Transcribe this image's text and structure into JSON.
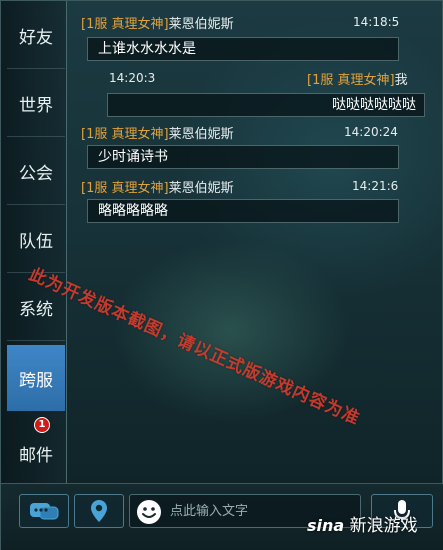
{
  "sidebar": {
    "items": [
      {
        "label": "好友"
      },
      {
        "label": "世界"
      },
      {
        "label": "公会"
      },
      {
        "label": "队伍"
      },
      {
        "label": "系统"
      },
      {
        "label": "跨服"
      },
      {
        "label": "邮件",
        "badge": "1"
      }
    ],
    "active_index": 5
  },
  "messages": [
    {
      "channel": "[1服",
      "sender": "真理女神]",
      "name": "莱恩伯妮斯",
      "time": "14:18:5",
      "text": "上谁水水水水是",
      "own": false
    },
    {
      "channel": "[1服",
      "sender": "真理女神]",
      "name": "我",
      "time": "14:20:3",
      "text": "哒哒哒哒哒哒",
      "own": true
    },
    {
      "channel": "[1服",
      "sender": "真理女神]",
      "name": "莱恩伯妮斯",
      "time": "14:20:24",
      "text": "少时诵诗书",
      "own": false
    },
    {
      "channel": "[1服",
      "sender": "真理女神]",
      "name": "莱恩伯妮斯",
      "time": "14:21:6",
      "text": "略略略略略",
      "own": false
    }
  ],
  "watermark": "此为开发版本截图，请以正式版游戏内容为准",
  "input": {
    "placeholder": "点此输入文字"
  },
  "icons": {
    "emote_button": "chat-bubbles-icon",
    "location_button": "location-pin-icon",
    "emoji": "smiley-icon",
    "voice_button": "microphone-icon"
  },
  "branding": {
    "sina": "sina",
    "text": "新浪游戏"
  },
  "colors": {
    "accent": "#3f86c7",
    "channel": "#e2a23a",
    "badge": "#d11a1a",
    "watermark": "#d63b2c"
  }
}
